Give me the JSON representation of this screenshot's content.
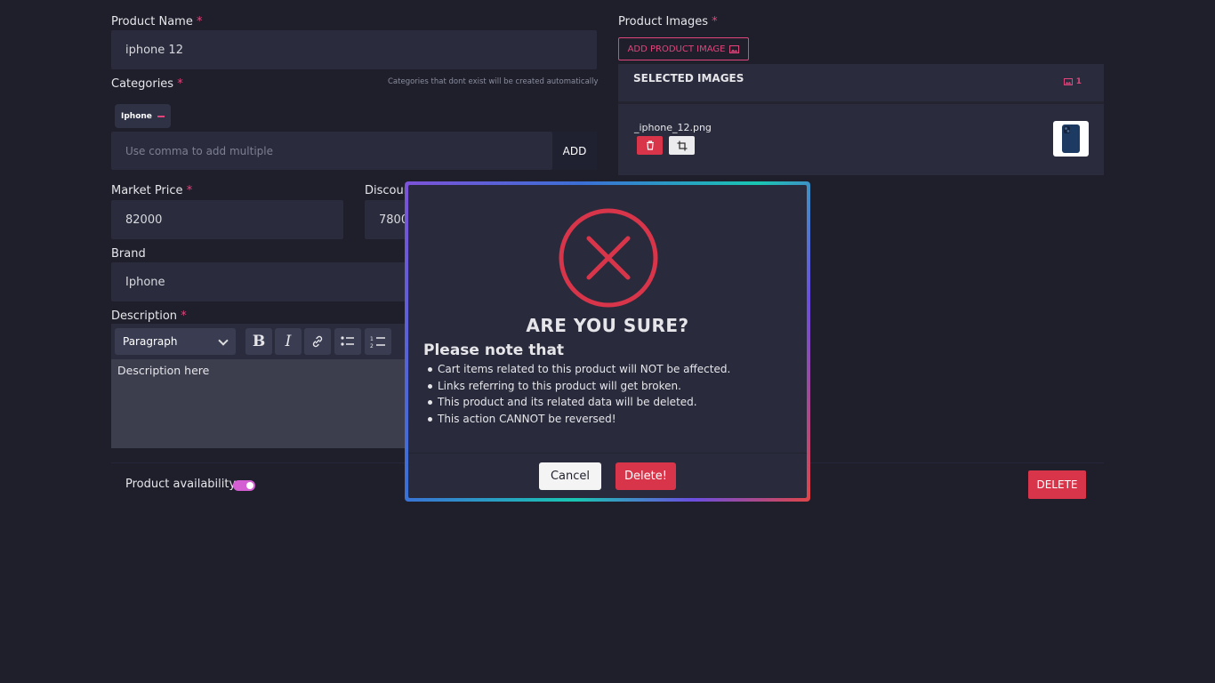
{
  "product_name": {
    "label": "Product Name",
    "required": "*",
    "value": "iphone 12"
  },
  "categories": {
    "label": "Categories",
    "required": "*",
    "hint": "Categories that dont exist will be created automatically",
    "chips": [
      "Iphone"
    ],
    "placeholder": "Use comma to add multiple",
    "add_label": "ADD"
  },
  "market_price": {
    "label": "Market Price",
    "required": "*",
    "value": "82000"
  },
  "discount_price": {
    "label": "Discoun",
    "value": "7800"
  },
  "brand": {
    "label": "Brand",
    "value": "Iphone"
  },
  "description": {
    "label": "Description",
    "required": "*",
    "block_format": "Paragraph",
    "content": "Description here"
  },
  "product_images": {
    "label": "Product Images",
    "required": "*",
    "add_label": "ADD PRODUCT IMAGE",
    "selected_title": "SELECTED IMAGES",
    "selected_count": "1",
    "images": [
      {
        "filename": "_iphone_12.png"
      }
    ]
  },
  "availability": {
    "label": "Product availability",
    "enabled": true
  },
  "delete_button": "DELETE",
  "modal": {
    "title": "ARE YOU SURE?",
    "note": "Please note that",
    "items": [
      "Cart items related to this product will NOT be affected.",
      "Links referring to this product will get broken.",
      "This product and its related data will be deleted.",
      "This action CANNOT be reversed!"
    ],
    "cancel_label": "Cancel",
    "confirm_label": "Delete!"
  },
  "colors": {
    "background": "#1e1f2b",
    "field": "#2a2c3d",
    "accent": "#e0457b",
    "danger": "#d8354a"
  },
  "icons": [
    "image-icon",
    "trash-icon",
    "crop-icon",
    "bold-icon",
    "italic-icon",
    "link-icon",
    "bulleted-list-icon",
    "numbered-list-icon",
    "error-x-icon"
  ]
}
